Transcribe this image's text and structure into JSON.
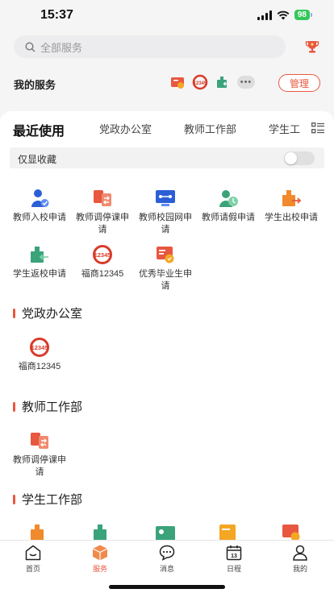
{
  "status": {
    "time": "15:37",
    "battery": "98"
  },
  "search": {
    "placeholder": "全部服务"
  },
  "my_services": {
    "title": "我的服务",
    "manage_label": "管理",
    "more_label": "•••"
  },
  "tabs": [
    "最近使用",
    "党政办公室",
    "教师工作部",
    "学生工"
  ],
  "favorites": {
    "label": "仅显收藏",
    "enabled": false
  },
  "recent": [
    {
      "label": "教师入校申请",
      "icon": "teacher-enter-icon"
    },
    {
      "label": "教师调停课申请",
      "icon": "class-swap-icon"
    },
    {
      "label": "教师校园网申请",
      "icon": "campus-network-icon"
    },
    {
      "label": "教师请假申请",
      "icon": "leave-request-icon"
    },
    {
      "label": "学生出校申请",
      "icon": "student-exit-icon"
    },
    {
      "label": "学生返校申请",
      "icon": "student-return-icon"
    },
    {
      "label": "福商12345",
      "icon": "hotline-12345-icon"
    },
    {
      "label": "优秀毕业生申请",
      "icon": "graduate-award-icon"
    }
  ],
  "sections": [
    {
      "title": "党政办公室",
      "apps": [
        {
          "label": "福商12345",
          "icon": "hotline-12345-icon"
        }
      ]
    },
    {
      "title": "教师工作部",
      "apps": [
        {
          "label": "教师调停课申请",
          "icon": "class-swap-icon"
        }
      ]
    },
    {
      "title": "学生工作部"
    }
  ],
  "tabbar": [
    {
      "label": "首页",
      "icon": "home-icon"
    },
    {
      "label": "服务",
      "icon": "service-box-icon"
    },
    {
      "label": "消息",
      "icon": "message-icon"
    },
    {
      "label": "日程",
      "icon": "calendar-icon"
    },
    {
      "label": "我的",
      "icon": "user-icon"
    }
  ],
  "colors": {
    "accent": "#e8573f",
    "blue": "#2c5fd6",
    "green": "#3aa37a",
    "orange": "#f08a2c"
  }
}
